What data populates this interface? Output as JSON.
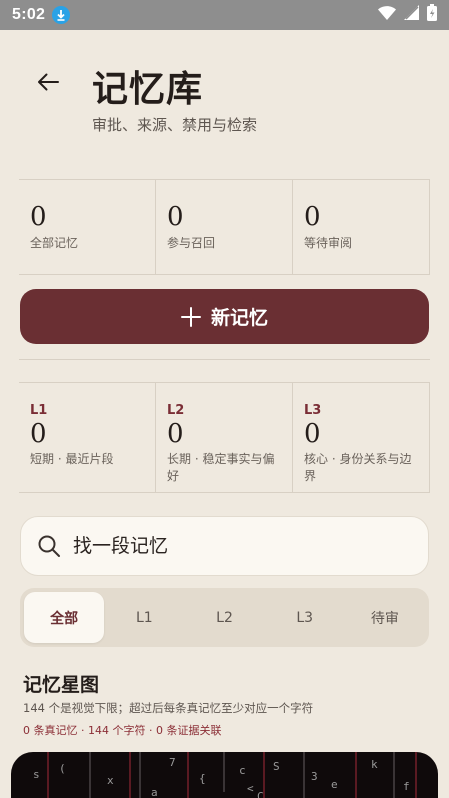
{
  "status_bar": {
    "time": "5:02"
  },
  "header": {
    "title": "记忆库",
    "subtitle": "审批、来源、禁用与检索"
  },
  "stats": [
    {
      "value": "0",
      "label": "全部记忆"
    },
    {
      "value": "0",
      "label": "参与召回"
    },
    {
      "value": "0",
      "label": "等待审阅"
    }
  ],
  "new_button": {
    "label": "新记忆"
  },
  "levels": [
    {
      "tag": "L1",
      "value": "0",
      "desc": "短期 · 最近片段"
    },
    {
      "tag": "L2",
      "value": "0",
      "desc": "长期 · 稳定事实与偏好"
    },
    {
      "tag": "L3",
      "value": "0",
      "desc": "核心 · 身份关系与边界"
    }
  ],
  "search": {
    "placeholder": "找一段记忆"
  },
  "tabs": [
    "全部",
    "L1",
    "L2",
    "L3",
    "待审"
  ],
  "starmap": {
    "title": "记忆星图",
    "description": "144 个是视觉下限；超过后每条真记忆至少对应一个字符",
    "meta": "0 条真记忆 · 144 个字符 · 0 条证据关联",
    "glyphs": [
      "s",
      "(",
      "x",
      "7",
      "{",
      "c",
      "<",
      "S",
      "3",
      "e",
      "k",
      "C",
      "a",
      "f"
    ]
  },
  "colors": {
    "accent": "#6a2f33",
    "level_tag": "#7a2d35",
    "background": "#efe9df"
  }
}
